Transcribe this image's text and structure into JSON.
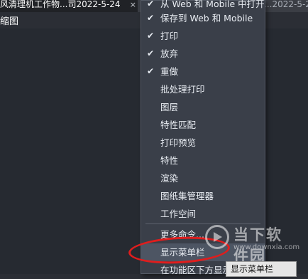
{
  "tabs": [
    {
      "title": "风清理机工作物...司2022-5-24",
      "close": "×"
    },
    {
      "title": "...2022-5-24"
    }
  ],
  "document": {
    "label": "缩图"
  },
  "menu": {
    "items": [
      {
        "label": "从 Web 和 Mobile 中打开",
        "checked": "✔"
      },
      {
        "label": "保存到 Web 和 Mobile",
        "checked": "✔"
      },
      {
        "label": "打印",
        "checked": "✔"
      },
      {
        "label": "放弃",
        "checked": "✔"
      },
      {
        "label": "重做",
        "checked": "✔"
      },
      {
        "label": "批处理打印",
        "checked": ""
      },
      {
        "label": "图层",
        "checked": ""
      },
      {
        "label": "特性匹配",
        "checked": ""
      },
      {
        "label": "打印预览",
        "checked": ""
      },
      {
        "label": "特性",
        "checked": ""
      },
      {
        "label": "渲染",
        "checked": ""
      },
      {
        "label": "图纸集管理器",
        "checked": ""
      },
      {
        "label": "工作空间",
        "checked": ""
      },
      {
        "label": "更多命令...",
        "checked": ""
      },
      {
        "label": "显示菜单栏",
        "checked": ""
      },
      {
        "label": "在功能区下方显示",
        "checked": ""
      }
    ],
    "scroll_down": "▾"
  },
  "tooltip": {
    "text": "显示菜单栏"
  },
  "watermark": {
    "title": "当下软件园",
    "url": "www.downxia.com"
  },
  "colors": {
    "menu_bg": "#3a3f49",
    "annotation": "#e01d1d",
    "background": "#2b2e35"
  }
}
